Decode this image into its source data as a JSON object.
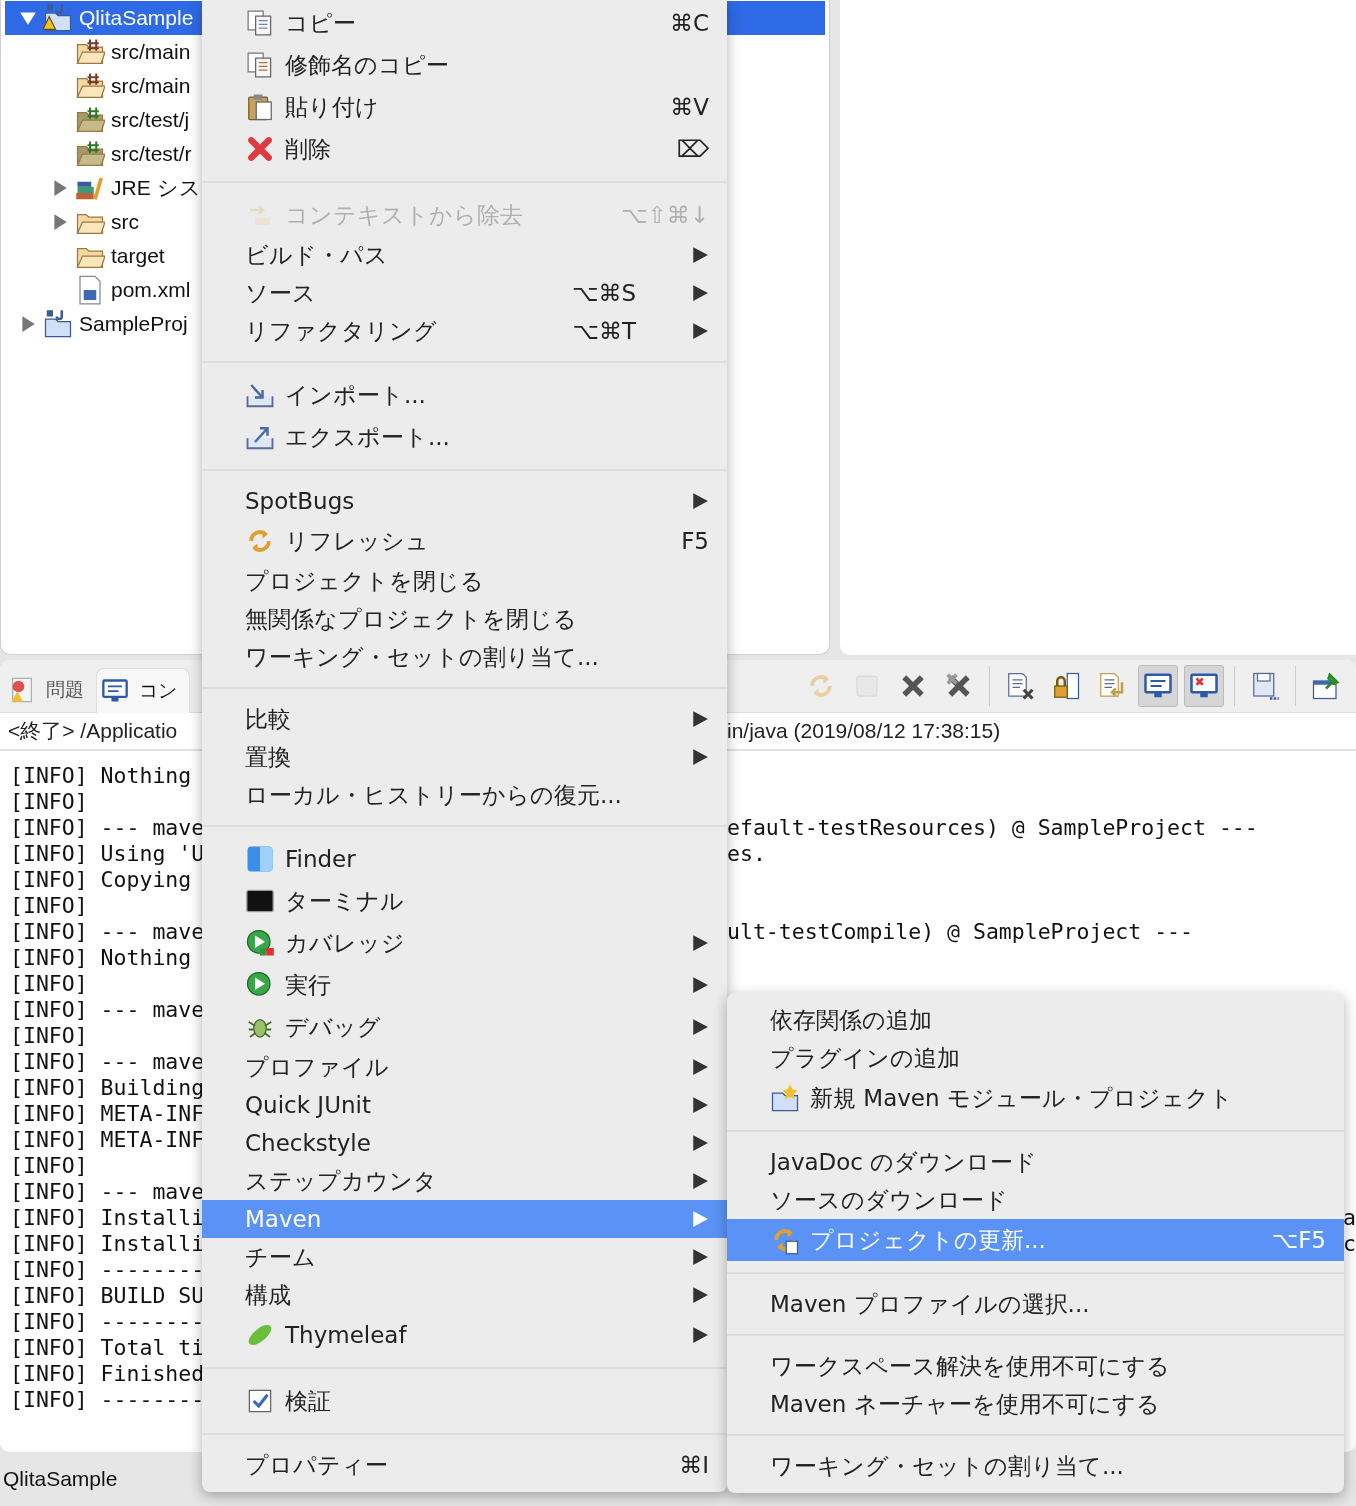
{
  "project_tree": {
    "items": [
      {
        "label": "QlitaSample",
        "kind": "project_warning",
        "expanded": true,
        "selected": true,
        "children": [
          {
            "label": "src/main",
            "kind": "package_folder",
            "selected": false
          },
          {
            "label": "src/main",
            "kind": "package_folder",
            "selected": false
          },
          {
            "label": "src/test/j",
            "kind": "test_package_folder",
            "selected": false
          },
          {
            "label": "src/test/r",
            "kind": "test_package_folder",
            "selected": false
          },
          {
            "label": "JRE シス",
            "kind": "library",
            "expanded": false,
            "selected": false
          },
          {
            "label": "src",
            "kind": "folder",
            "expanded": false,
            "selected": false
          },
          {
            "label": "target",
            "kind": "folder",
            "selected": false
          },
          {
            "label": "pom.xml",
            "kind": "xml_file",
            "selected": false
          }
        ]
      },
      {
        "label": "SampleProj",
        "kind": "project",
        "expanded": false,
        "selected": false
      }
    ]
  },
  "console": {
    "tabs": [
      {
        "label": "問題",
        "kind": "problems",
        "selected": false
      },
      {
        "label": "コン",
        "kind": "console",
        "selected": true
      }
    ],
    "toolbar": [
      {
        "kind": "refresh",
        "disabled": true,
        "pressed": false
      },
      {
        "kind": "stop",
        "disabled": true,
        "pressed": false
      },
      {
        "kind": "remove",
        "disabled": false,
        "pressed": false
      },
      {
        "kind": "remove_all",
        "disabled": false,
        "pressed": false
      },
      {
        "kind": "clear",
        "disabled": false,
        "pressed": false
      },
      {
        "kind": "lock",
        "disabled": false,
        "pressed": false
      },
      {
        "kind": "wrap",
        "disabled": false,
        "pressed": false
      },
      {
        "kind": "stdout",
        "disabled": false,
        "pressed": true
      },
      {
        "kind": "stderr",
        "disabled": false,
        "pressed": true
      },
      {
        "kind": "save",
        "disabled": false,
        "pressed": false
      },
      {
        "kind": "pin",
        "disabled": false,
        "pressed": false
      }
    ],
    "header_left": "<終了> /Applicatio",
    "header_right": "in/java (2019/08/12 17:38:15)",
    "lines": [
      {
        "left": "[INFO] Nothing"
      },
      {
        "left": "[INFO]"
      },
      {
        "left": "[INFO] --- mave",
        "right": "efault-testResources) @ SampleProject ---"
      },
      {
        "left": "[INFO] Using 'U",
        "right": "es."
      },
      {
        "left": "[INFO] Copying"
      },
      {
        "left": "[INFO]"
      },
      {
        "left": "[INFO] --- mave",
        "right": "ult-testCompile) @ SampleProject ---"
      },
      {
        "left": "[INFO] Nothing"
      },
      {
        "left": "[INFO]"
      },
      {
        "left": "[INFO] --- mave"
      },
      {
        "left": "[INFO]"
      },
      {
        "left": "[INFO] --- mave"
      },
      {
        "left": "[INFO] Building"
      },
      {
        "left": "[INFO] META-INF"
      },
      {
        "left": "[INFO] META-INF"
      },
      {
        "left": "[INFO]"
      },
      {
        "left": "[INFO] --- mave"
      },
      {
        "left": "[INFO] Installi",
        "tail": "a"
      },
      {
        "left": "[INFO] Installi",
        "tail": "c"
      },
      {
        "left": "[INFO] --------"
      },
      {
        "left": "[INFO] BUILD SU"
      },
      {
        "left": "[INFO] --------"
      },
      {
        "left": "[INFO] Total ti"
      },
      {
        "left": "[INFO] Finished"
      },
      {
        "left": "[INFO] --------"
      }
    ]
  },
  "status_bar": {
    "text": "QlitaSample"
  },
  "context_menu": {
    "groups": [
      {
        "items": [
          {
            "label": "コピー",
            "kind": "copy",
            "shortcut": "⌘C",
            "submenu": false,
            "disabled": false,
            "selected": false
          },
          {
            "label": "修飾名のコピー",
            "kind": "copy_qualified",
            "submenu": false,
            "disabled": false,
            "selected": false
          },
          {
            "label": "貼り付け",
            "kind": "paste",
            "shortcut": "⌘V",
            "submenu": false,
            "disabled": false,
            "selected": false
          },
          {
            "label": "削除",
            "kind": "delete",
            "shortcut": "⌦",
            "submenu": false,
            "disabled": false,
            "selected": false
          }
        ]
      },
      {
        "items": [
          {
            "label": "コンテキストから除去",
            "kind": "remove_context",
            "shortcut": "⌥⇧⌘↓",
            "submenu": false,
            "disabled": true,
            "selected": false
          },
          {
            "label": "ビルド・パス",
            "submenu": true,
            "disabled": false,
            "selected": false
          },
          {
            "label": "ソース",
            "shortcut": "⌥⌘S",
            "submenu": true,
            "disabled": false,
            "selected": false
          },
          {
            "label": "リファクタリング",
            "shortcut": "⌥⌘T",
            "submenu": true,
            "disabled": false,
            "selected": false
          }
        ]
      },
      {
        "items": [
          {
            "label": "インポート...",
            "kind": "import",
            "submenu": false,
            "disabled": false,
            "selected": false
          },
          {
            "label": "エクスポート...",
            "kind": "export",
            "submenu": false,
            "disabled": false,
            "selected": false
          }
        ]
      },
      {
        "items": [
          {
            "label": "SpotBugs",
            "submenu": true,
            "disabled": false,
            "selected": false
          },
          {
            "label": "リフレッシュ",
            "kind": "refresh",
            "shortcut": "F5",
            "submenu": false,
            "disabled": false,
            "selected": false
          },
          {
            "label": "プロジェクトを閉じる",
            "submenu": false,
            "disabled": false,
            "selected": false
          },
          {
            "label": "無関係なプロジェクトを閉じる",
            "submenu": false,
            "disabled": false,
            "selected": false
          },
          {
            "label": "ワーキング・セットの割り当て...",
            "submenu": false,
            "disabled": false,
            "selected": false
          }
        ]
      },
      {
        "items": [
          {
            "label": "比較",
            "submenu": true,
            "disabled": false,
            "selected": false
          },
          {
            "label": "置換",
            "submenu": true,
            "disabled": false,
            "selected": false
          },
          {
            "label": "ローカル・ヒストリーからの復元...",
            "submenu": false,
            "disabled": false,
            "selected": false
          }
        ]
      },
      {
        "items": [
          {
            "label": "Finder",
            "kind": "finder",
            "submenu": false,
            "disabled": false,
            "selected": false
          },
          {
            "label": "ターミナル",
            "kind": "terminal",
            "submenu": false,
            "disabled": false,
            "selected": false
          },
          {
            "label": "カバレッジ",
            "kind": "coverage",
            "submenu": true,
            "disabled": false,
            "selected": false
          },
          {
            "label": "実行",
            "kind": "run",
            "submenu": true,
            "disabled": false,
            "selected": false
          },
          {
            "label": "デバッグ",
            "kind": "debug",
            "submenu": true,
            "disabled": false,
            "selected": false
          },
          {
            "label": "プロファイル",
            "submenu": true,
            "disabled": false,
            "selected": false
          },
          {
            "label": "Quick JUnit",
            "submenu": true,
            "disabled": false,
            "selected": false
          },
          {
            "label": "Checkstyle",
            "submenu": true,
            "disabled": false,
            "selected": false
          },
          {
            "label": "ステップカウンタ",
            "submenu": true,
            "disabled": false,
            "selected": false
          },
          {
            "label": "Maven",
            "submenu": true,
            "disabled": false,
            "selected": true
          },
          {
            "label": "チーム",
            "submenu": true,
            "disabled": false,
            "selected": false
          },
          {
            "label": "構成",
            "submenu": true,
            "disabled": false,
            "selected": false
          },
          {
            "label": "Thymeleaf",
            "kind": "leaf",
            "submenu": true,
            "disabled": false,
            "selected": false
          }
        ]
      },
      {
        "items": [
          {
            "label": "検証",
            "kind": "validate",
            "submenu": false,
            "disabled": false,
            "selected": false
          }
        ]
      },
      {
        "items": [
          {
            "label": "プロパティー",
            "shortcut": "⌘I",
            "submenu": false,
            "disabled": false,
            "selected": false
          }
        ]
      }
    ]
  },
  "submenu": {
    "groups": [
      {
        "items": [
          {
            "label": "依存関係の追加",
            "submenu": false,
            "disabled": false,
            "selected": false
          },
          {
            "label": "プラグインの追加",
            "submenu": false,
            "disabled": false,
            "selected": false
          },
          {
            "label": "新規 Maven モジュール・プロジェクト",
            "kind": "maven_module",
            "submenu": false,
            "disabled": false,
            "selected": false
          }
        ]
      },
      {
        "items": [
          {
            "label": "JavaDoc のダウンロード",
            "submenu": false,
            "disabled": false,
            "selected": false
          },
          {
            "label": "ソースのダウンロード",
            "submenu": false,
            "disabled": false,
            "selected": false
          },
          {
            "label": "プロジェクトの更新...",
            "kind": "maven_update",
            "shortcut": "⌥F5",
            "submenu": false,
            "disabled": false,
            "selected": true
          }
        ]
      },
      {
        "items": [
          {
            "label": "Maven プロファイルの選択...",
            "submenu": false,
            "disabled": false,
            "selected": false
          }
        ]
      },
      {
        "items": [
          {
            "label": "ワークスペース解決を使用不可にする",
            "submenu": false,
            "disabled": false,
            "selected": false
          },
          {
            "label": "Maven ネーチャーを使用不可にする",
            "submenu": false,
            "disabled": false,
            "selected": false
          }
        ]
      },
      {
        "items": [
          {
            "label": "ワーキング・セットの割り当て...",
            "submenu": false,
            "disabled": false,
            "selected": false
          }
        ]
      }
    ]
  }
}
